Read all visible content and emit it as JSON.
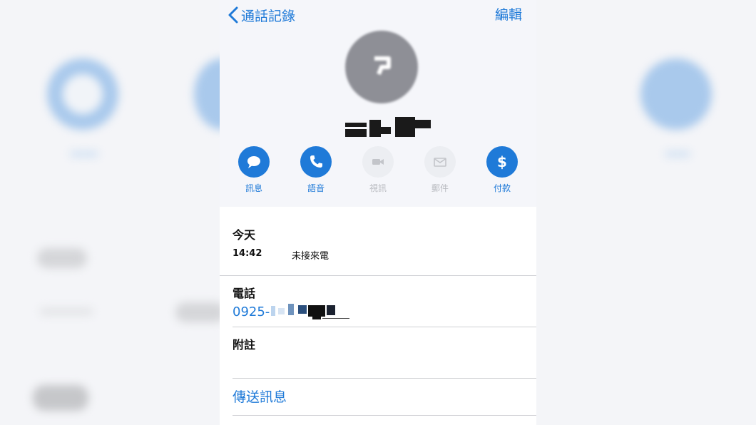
{
  "nav": {
    "back_label": "通話記錄",
    "edit_label": "編輯"
  },
  "actions": [
    {
      "label": "訊息",
      "icon": "message-bubble-icon",
      "enabled": true
    },
    {
      "label": "語音",
      "icon": "phone-icon",
      "enabled": true
    },
    {
      "label": "視訊",
      "icon": "video-camera-icon",
      "enabled": false
    },
    {
      "label": "郵件",
      "icon": "mail-envelope-icon",
      "enabled": false
    },
    {
      "label": "付款",
      "icon": "dollar-icon",
      "enabled": true
    }
  ],
  "call_log": {
    "title": "今天",
    "time": "14:42",
    "status": "未接來電"
  },
  "phone": {
    "label": "電話",
    "number_prefix": "0925-"
  },
  "notes": {
    "label": "附註"
  },
  "send_message_label": "傳送訊息",
  "colors": {
    "accent": "#1f7ad8",
    "header_bg": "#f5f6fa",
    "disabled_circle": "#eceef2",
    "disabled_text": "#b9bbc0"
  }
}
